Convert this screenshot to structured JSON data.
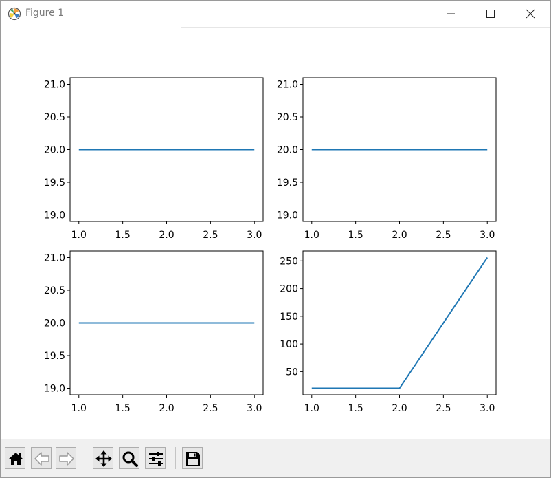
{
  "window": {
    "title": "Figure 1",
    "controls": [
      "minimize-icon",
      "maximize-icon",
      "close-icon"
    ]
  },
  "toolbar": {
    "buttons": [
      {
        "name": "home",
        "icon": "home-icon"
      },
      {
        "name": "back",
        "icon": "arrow-left-icon"
      },
      {
        "name": "forward",
        "icon": "arrow-right-icon"
      },
      {
        "name": "pan",
        "icon": "move-icon"
      },
      {
        "name": "zoom",
        "icon": "magnifier-icon"
      },
      {
        "name": "configure-subplots",
        "icon": "sliders-icon"
      },
      {
        "name": "save",
        "icon": "floppy-disk-icon"
      }
    ]
  },
  "colors": {
    "line": "#1f77b4",
    "toolbar_bg": "#f0f0f0",
    "window_border": "#9a9a9a"
  },
  "chart_data": [
    {
      "type": "line",
      "x": [
        1.0,
        2.0,
        3.0
      ],
      "series": [
        {
          "values": [
            20,
            20,
            20
          ]
        }
      ],
      "xlim": [
        0.9,
        3.1
      ],
      "ylim": [
        18.9,
        21.1
      ],
      "xticks": [
        "1.0",
        "1.5",
        "2.0",
        "2.5",
        "3.0"
      ],
      "yticks": [
        "19.0",
        "19.5",
        "20.0",
        "20.5",
        "21.0"
      ],
      "grid": false
    },
    {
      "type": "line",
      "x": [
        1.0,
        2.0,
        3.0
      ],
      "series": [
        {
          "values": [
            20,
            20,
            20
          ]
        }
      ],
      "xlim": [
        0.9,
        3.1
      ],
      "ylim": [
        18.9,
        21.1
      ],
      "xticks": [
        "1.0",
        "1.5",
        "2.0",
        "2.5",
        "3.0"
      ],
      "yticks": [
        "19.0",
        "19.5",
        "20.0",
        "20.5",
        "21.0"
      ],
      "grid": false
    },
    {
      "type": "line",
      "x": [
        1.0,
        2.0,
        3.0
      ],
      "series": [
        {
          "values": [
            20,
            20,
            20
          ]
        }
      ],
      "xlim": [
        0.9,
        3.1
      ],
      "ylim": [
        18.9,
        21.1
      ],
      "xticks": [
        "1.0",
        "1.5",
        "2.0",
        "2.5",
        "3.0"
      ],
      "yticks": [
        "19.0",
        "19.5",
        "20.0",
        "20.5",
        "21.0"
      ],
      "grid": false
    },
    {
      "type": "line",
      "x": [
        1.0,
        2.0,
        3.0
      ],
      "series": [
        {
          "values": [
            20,
            20,
            256
          ]
        }
      ],
      "xlim": [
        0.9,
        3.1
      ],
      "ylim": [
        8.2,
        267.8
      ],
      "xticks": [
        "1.0",
        "1.5",
        "2.0",
        "2.5",
        "3.0"
      ],
      "yticks": [
        "50",
        "100",
        "150",
        "200",
        "250"
      ],
      "grid": false
    }
  ]
}
